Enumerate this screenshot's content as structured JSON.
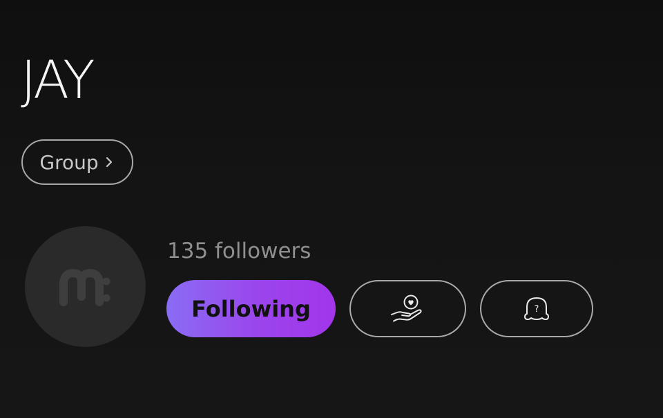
{
  "profile": {
    "name": "JAY",
    "group_label": "Group",
    "group_icon": "chevron-right-icon",
    "avatar_icon": "m-logo-icon",
    "followers_text": "135 followers"
  },
  "actions": {
    "following_label": "Following",
    "support_icon": "hand-heart-icon",
    "help_icon": "question-bubble-icon"
  },
  "colors": {
    "background": "#131313",
    "following_gradient_start": "#8a6cf4",
    "following_gradient_end": "#a235ea",
    "outline": "#a9a9a9"
  }
}
